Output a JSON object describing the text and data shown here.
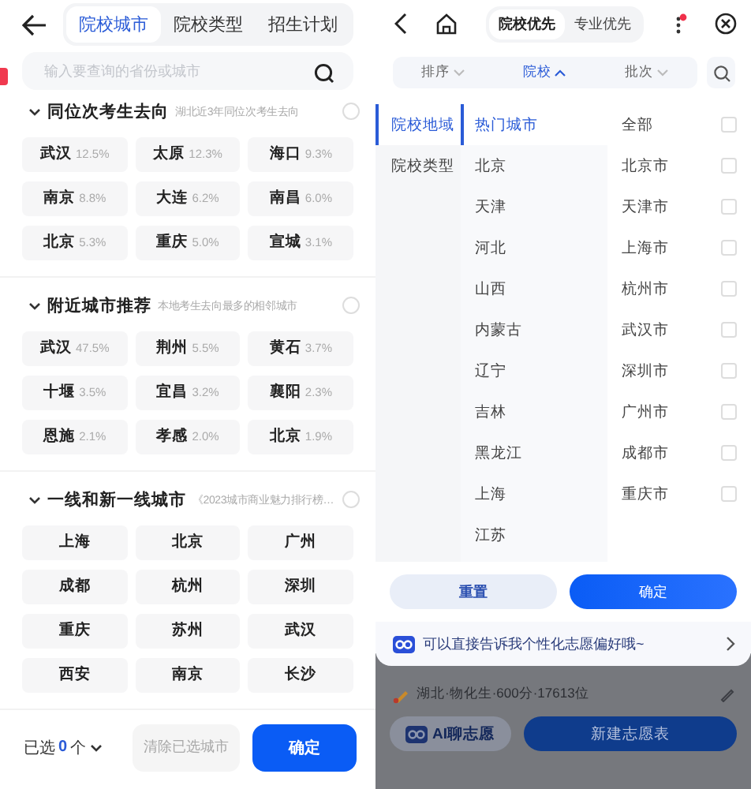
{
  "left": {
    "tabs": [
      {
        "label": "院校城市",
        "selected": true
      },
      {
        "label": "院校类型",
        "selected": false
      },
      {
        "label": "招生计划",
        "selected": false
      }
    ],
    "search": {
      "placeholder": "输入要查询的省份或城市"
    },
    "sections": [
      {
        "title": "同位次考生去向",
        "subtitle": "湖北近3年同位次考生去向",
        "expanded": true,
        "checked": false,
        "cities": [
          {
            "name": "武汉",
            "share": "12.5%"
          },
          {
            "name": "太原",
            "share": "12.3%"
          },
          {
            "name": "海口",
            "share": "9.3%"
          },
          {
            "name": "南京",
            "share": "8.8%"
          },
          {
            "name": "大连",
            "share": "6.2%"
          },
          {
            "name": "南昌",
            "share": "6.0%"
          },
          {
            "name": "北京",
            "share": "5.3%"
          },
          {
            "name": "重庆",
            "share": "5.0%"
          },
          {
            "name": "宣城",
            "share": "3.1%"
          }
        ]
      },
      {
        "title": "附近城市推荐",
        "subtitle": "本地考生去向最多的相邻城市",
        "expanded": true,
        "checked": false,
        "cities": [
          {
            "name": "武汉",
            "share": "47.5%"
          },
          {
            "name": "荆州",
            "share": "5.5%"
          },
          {
            "name": "黄石",
            "share": "3.7%"
          },
          {
            "name": "十堰",
            "share": "3.5%"
          },
          {
            "name": "宜昌",
            "share": "3.2%"
          },
          {
            "name": "襄阳",
            "share": "2.3%"
          },
          {
            "name": "恩施",
            "share": "2.1%"
          },
          {
            "name": "孝感",
            "share": "2.0%"
          },
          {
            "name": "北京",
            "share": "1.9%"
          }
        ]
      },
      {
        "title": "一线和新一线城市",
        "subtitle": "《2023城市商业魅力排行榜…",
        "expanded": true,
        "checked": false,
        "cities": [
          {
            "name": "上海"
          },
          {
            "name": "北京"
          },
          {
            "name": "广州"
          },
          {
            "name": "成都"
          },
          {
            "name": "杭州"
          },
          {
            "name": "深圳"
          },
          {
            "name": "重庆"
          },
          {
            "name": "苏州"
          },
          {
            "name": "武汉"
          },
          {
            "name": "西安"
          },
          {
            "name": "南京"
          },
          {
            "name": "长沙"
          }
        ]
      }
    ],
    "footer": {
      "label": "已选",
      "count": "0",
      "unit": "个",
      "clear": {
        "label": "清除已选城市",
        "disabled": true
      },
      "confirm": "确定"
    }
  },
  "right": {
    "segments": [
      {
        "label": "院校优先",
        "selected": true
      },
      {
        "label": "专业优先",
        "selected": false
      }
    ],
    "notification": true,
    "filters": [
      {
        "label": "排序",
        "selected": false
      },
      {
        "label": "院校",
        "selected": true
      },
      {
        "label": "批次",
        "selected": false
      }
    ],
    "categories": [
      {
        "label": "院校地域",
        "selected": true
      },
      {
        "label": "院校类型",
        "selected": false
      }
    ],
    "regions": [
      {
        "label": "热门城市",
        "selected": true
      },
      {
        "label": "北京",
        "selected": false
      },
      {
        "label": "天津",
        "selected": false
      },
      {
        "label": "河北",
        "selected": false
      },
      {
        "label": "山西",
        "selected": false
      },
      {
        "label": "内蒙古",
        "selected": false
      },
      {
        "label": "辽宁",
        "selected": false
      },
      {
        "label": "吉林",
        "selected": false
      },
      {
        "label": "黑龙江",
        "selected": false
      },
      {
        "label": "上海",
        "selected": false
      },
      {
        "label": "江苏",
        "selected": false
      }
    ],
    "cities": [
      {
        "label": "全部",
        "checked": false
      },
      {
        "label": "北京市",
        "checked": false
      },
      {
        "label": "天津市",
        "checked": false
      },
      {
        "label": "上海市",
        "checked": false
      },
      {
        "label": "杭州市",
        "checked": false
      },
      {
        "label": "武汉市",
        "checked": false
      },
      {
        "label": "深圳市",
        "checked": false
      },
      {
        "label": "广州市",
        "checked": false
      },
      {
        "label": "成都市",
        "checked": false
      },
      {
        "label": "重庆市",
        "checked": false
      }
    ],
    "buttons": [
      "重置",
      "确定"
    ],
    "banner": "可以直接告诉我个性化志愿偏好哦~",
    "background": {
      "info": "湖北·物化生·600分·17613位",
      "ai_button": "AI聊志愿",
      "new_button": "新建志愿表"
    }
  }
}
